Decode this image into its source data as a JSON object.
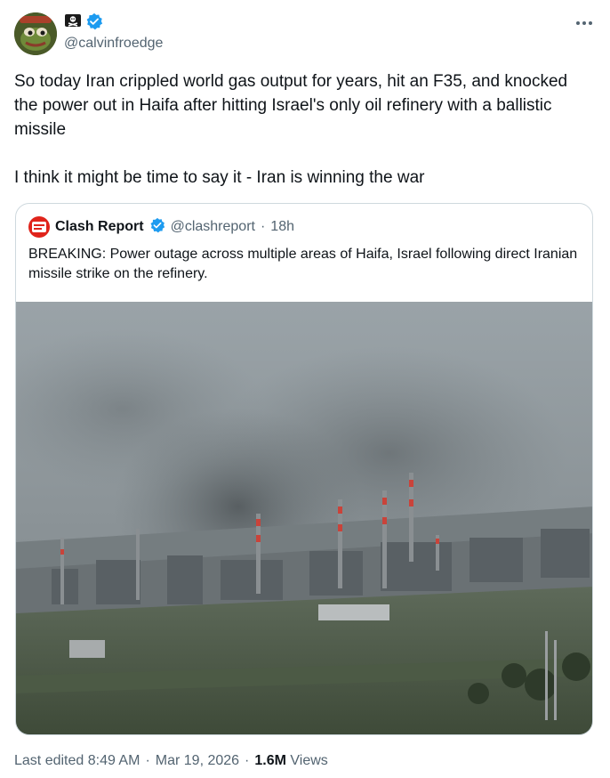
{
  "author": {
    "handle": "@calvinfroedge",
    "badge_icon": "pirate-flag-icon",
    "verified_icon": "verified-badge-icon",
    "verified_color": "#1d9bf0"
  },
  "tweet": {
    "text": "So today Iran crippled world gas output for years, hit an F35, and knocked the power out in Haifa after hitting Israel's only oil refinery with a ballistic missile\n\nI think it might be time to say it - Iran is winning the war"
  },
  "quote": {
    "name": "Clash Report",
    "handle": "@clashreport",
    "separator": "·",
    "time": "18h",
    "logo_text": "CLASH REPORT",
    "text": "BREAKING: Power outage across multiple areas of Haifa, Israel following direct Iranian missile strike on the refinery.",
    "image_icon": "refinery-smoke-photo"
  },
  "meta": {
    "edited": "Last edited 8:49 AM",
    "separator": "·",
    "date": "Mar 19, 2026",
    "views_count": "1.6M",
    "views_label": "Views"
  }
}
